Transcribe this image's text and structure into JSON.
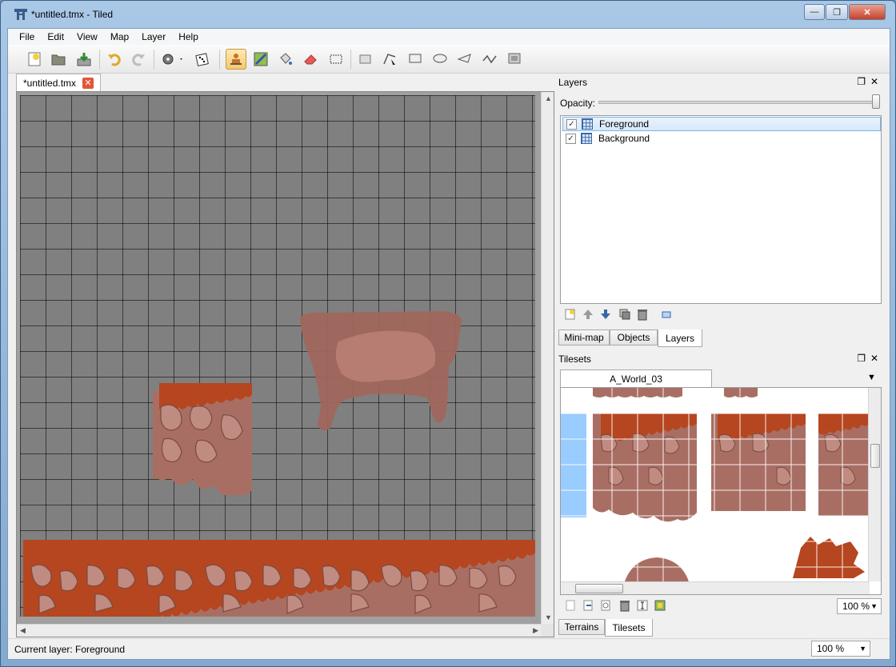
{
  "window": {
    "title": "*untitled.tmx - Tiled",
    "minimize": "—",
    "maximize": "❐",
    "close": "✕"
  },
  "menu": [
    "File",
    "Edit",
    "View",
    "Map",
    "Layer",
    "Help"
  ],
  "toolbar": {
    "new_icon": "new-map-icon",
    "open_icon": "open-folder-icon",
    "save_icon": "save-icon",
    "undo_icon": "undo-icon",
    "redo_icon": "redo-icon",
    "commands_icon": "gears-icon",
    "random_icon": "dice-icon",
    "stamp_icon": "stamp-brush-icon",
    "terrain_icon": "terrain-brush-icon",
    "fill_icon": "bucket-fill-icon",
    "eraser_icon": "eraser-icon",
    "rect_select_icon": "rectangle-select-icon",
    "select_objects_icon": "select-objects-icon",
    "edit_polygons_icon": "edit-polygons-icon",
    "insert_rect_icon": "insert-rectangle-icon",
    "insert_ellipse_icon": "insert-ellipse-icon",
    "insert_polygon_icon": "insert-polygon-icon",
    "insert_polyline_icon": "insert-polyline-icon",
    "insert_tile_icon": "insert-tile-icon"
  },
  "document_tab": {
    "label": "*untitled.tmx",
    "close": "✕"
  },
  "status": {
    "current_layer": "Current layer: Foreground",
    "zoom": "100 %"
  },
  "layers_dock": {
    "title": "Layers",
    "opacity_label": "Opacity:",
    "opacity": 1.0,
    "layers": [
      {
        "name": "Foreground",
        "visible": true,
        "selected": true
      },
      {
        "name": "Background",
        "visible": true,
        "selected": false
      }
    ],
    "tabs": [
      "Mini-map",
      "Objects",
      "Layers"
    ],
    "active_tab": "Layers"
  },
  "tilesets_dock": {
    "title": "Tilesets",
    "tileset_tab": "A_World_03",
    "zoom": "100 %",
    "tabs": [
      "Terrains",
      "Tilesets"
    ],
    "active_tab": "Tilesets"
  },
  "colors": {
    "accent": "#3399ff",
    "tile_body": "#a26a5f",
    "tile_top": "#b9461f",
    "map_bg": "#808080"
  }
}
